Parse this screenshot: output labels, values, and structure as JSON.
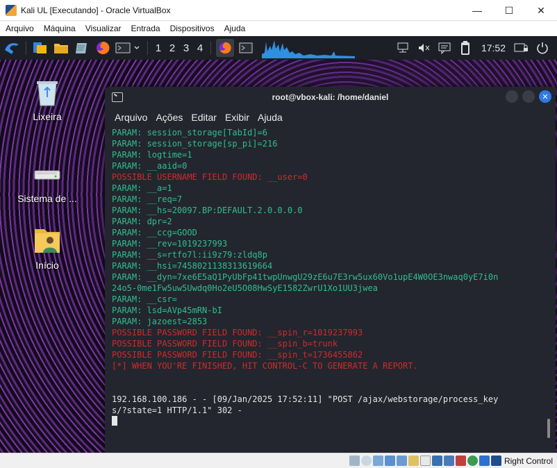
{
  "window": {
    "title": "Kali UL [Executando] - Oracle VirtualBox",
    "minimize": "—",
    "maximize": "☐",
    "close": "✕"
  },
  "vbox_menu": [
    "Arquivo",
    "Máquina",
    "Visualizar",
    "Entrada",
    "Dispositivos",
    "Ajuda"
  ],
  "kali_panel": {
    "workspaces": [
      "1",
      "2",
      "3",
      "4"
    ],
    "clock": "17:52"
  },
  "desktop_icons": [
    {
      "label": "Lixeira",
      "icon": "trash-icon"
    },
    {
      "label": "Sistema de ...",
      "icon": "drive-icon"
    },
    {
      "label": "Início",
      "icon": "home-folder-icon"
    }
  ],
  "terminal": {
    "title": "root@vbox-kali: /home/daniel",
    "menu": [
      "Arquivo",
      "Ações",
      "Editar",
      "Exibir",
      "Ajuda"
    ],
    "lines": [
      {
        "text": "PARAM: session_storage[TabId]=6",
        "color": "green"
      },
      {
        "text": "PARAM: session_storage[sp_pi]=216",
        "color": "green"
      },
      {
        "text": "PARAM: logtime=1",
        "color": "green"
      },
      {
        "text": "PARAM: __aaid=0",
        "color": "green"
      },
      {
        "text": "POSSIBLE USERNAME FIELD FOUND: __user=0",
        "color": "red"
      },
      {
        "text": "PARAM: __a=1",
        "color": "green"
      },
      {
        "text": "PARAM: __req=7",
        "color": "green"
      },
      {
        "text": "PARAM: __hs=20097.BP:DEFAULT.2.0.0.0.0",
        "color": "green"
      },
      {
        "text": "PARAM: dpr=2",
        "color": "green"
      },
      {
        "text": "PARAM: __ccg=GOOD",
        "color": "green"
      },
      {
        "text": "PARAM: __rev=1019237993",
        "color": "green"
      },
      {
        "text": "PARAM: __s=rtfo7l:ii9z79:zldq8p",
        "color": "green"
      },
      {
        "text": "PARAM: __hsi=7458021138313619664",
        "color": "green"
      },
      {
        "text": "PARAM: __dyn=7xe6E5aQ1PyUbFp41twpUnwgU29zE6u7E3rw5ux60Vo1upE4W0OE3nwaq0yE7i0n",
        "color": "green"
      },
      {
        "text": "24o5-0me1Fw5uw5Uwdq0Ho2eU5O08HwSyE1582ZwrU1Xo1UU3jwea",
        "color": "green"
      },
      {
        "text": "PARAM: __csr=",
        "color": "green"
      },
      {
        "text": "PARAM: lsd=AVp45mRN-bI",
        "color": "green"
      },
      {
        "text": "PARAM: jazoest=2853",
        "color": "green"
      },
      {
        "text": "POSSIBLE PASSWORD FIELD FOUND: __spin_r=1019237993",
        "color": "red"
      },
      {
        "text": "POSSIBLE PASSWORD FIELD FOUND: __spin_b=trunk",
        "color": "red"
      },
      {
        "text": "POSSIBLE PASSWORD FIELD FOUND: __spin_t=1736455862",
        "color": "red"
      },
      {
        "text": "[*] WHEN YOU'RE FINISHED, HIT CONTROL-C TO GENERATE A REPORT.",
        "color": "red"
      },
      {
        "text": "",
        "color": "white"
      },
      {
        "text": "",
        "color": "white"
      },
      {
        "text": "192.168.100.186 - - [09/Jan/2025 17:52:11] \"POST /ajax/webstorage/process_key",
        "color": "white"
      },
      {
        "text": "s/?state=1 HTTP/1.1\" 302 -",
        "color": "white"
      }
    ]
  },
  "status_bar": {
    "host_key": "Right Control"
  }
}
